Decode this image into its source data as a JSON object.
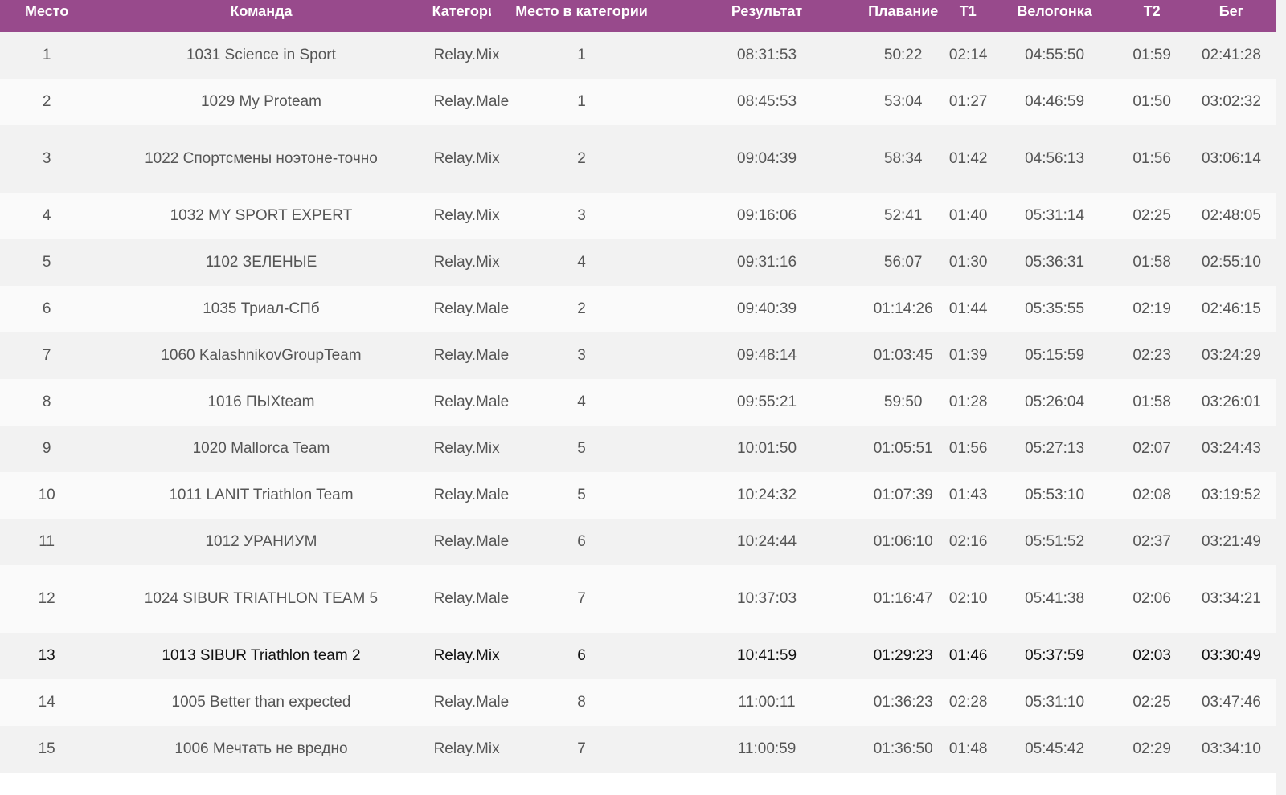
{
  "table": {
    "headers": [
      "Место",
      "Команда",
      "Категория",
      "Место в категории",
      "Результат",
      "Плавание",
      "T1",
      "Велогонка",
      "T2",
      "Бег"
    ],
    "rows": [
      [
        "1",
        "1031 Science in Sport",
        "Relay.Mix",
        "1",
        "08:31:53",
        "50:22",
        "02:14",
        "04:55:50",
        "01:59",
        "02:41:28"
      ],
      [
        "2",
        "1029 My Proteam",
        "Relay.Male",
        "1",
        "08:45:53",
        "53:04",
        "01:27",
        "04:46:59",
        "01:50",
        "03:02:32"
      ],
      [
        "3",
        "1022 Спортсмены ноэтоне-точно",
        "Relay.Mix",
        "2",
        "09:04:39",
        "58:34",
        "01:42",
        "04:56:13",
        "01:56",
        "03:06:14"
      ],
      [
        "4",
        "1032 MY SPORT EXPERT",
        "Relay.Mix",
        "3",
        "09:16:06",
        "52:41",
        "01:40",
        "05:31:14",
        "02:25",
        "02:48:05"
      ],
      [
        "5",
        "1102 ЗЕЛЕНЫЕ",
        "Relay.Mix",
        "4",
        "09:31:16",
        "56:07",
        "01:30",
        "05:36:31",
        "01:58",
        "02:55:10"
      ],
      [
        "6",
        "1035 Триал-СПб",
        "Relay.Male",
        "2",
        "09:40:39",
        "01:14:26",
        "01:44",
        "05:35:55",
        "02:19",
        "02:46:15"
      ],
      [
        "7",
        "1060 KalashnikovGroupTeam",
        "Relay.Male",
        "3",
        "09:48:14",
        "01:03:45",
        "01:39",
        "05:15:59",
        "02:23",
        "03:24:29"
      ],
      [
        "8",
        "1016 ПЫХteam",
        "Relay.Male",
        "4",
        "09:55:21",
        "59:50",
        "01:28",
        "05:26:04",
        "01:58",
        "03:26:01"
      ],
      [
        "9",
        "1020 Mallorca Team",
        "Relay.Mix",
        "5",
        "10:01:50",
        "01:05:51",
        "01:56",
        "05:27:13",
        "02:07",
        "03:24:43"
      ],
      [
        "10",
        "1011 LANIT Triathlon Team",
        "Relay.Male",
        "5",
        "10:24:32",
        "01:07:39",
        "01:43",
        "05:53:10",
        "02:08",
        "03:19:52"
      ],
      [
        "11",
        "1012 УРАНИУМ",
        "Relay.Male",
        "6",
        "10:24:44",
        "01:06:10",
        "02:16",
        "05:51:52",
        "02:37",
        "03:21:49"
      ],
      [
        "12",
        "1024 SIBUR TRIATHLON TEAM 5",
        "Relay.Male",
        "7",
        "10:37:03",
        "01:16:47",
        "02:10",
        "05:41:38",
        "02:06",
        "03:34:21"
      ],
      [
        "13",
        "1013 SIBUR Triathlon team 2",
        "Relay.Mix",
        "6",
        "10:41:59",
        "01:29:23",
        "01:46",
        "05:37:59",
        "02:03",
        "03:30:49"
      ],
      [
        "14",
        "1005 Better than expected",
        "Relay.Male",
        "8",
        "11:00:11",
        "01:36:23",
        "02:28",
        "05:31:10",
        "02:25",
        "03:47:46"
      ],
      [
        "15",
        "1006 Мечтать не вредно",
        "Relay.Mix",
        "7",
        "11:00:59",
        "01:36:50",
        "01:48",
        "05:45:42",
        "02:29",
        "03:34:10"
      ]
    ],
    "tall_rows": [
      2,
      11
    ],
    "highlight_row": 12
  },
  "colors": {
    "header_bg": "#984a8c",
    "header_text": "#ffffff",
    "row_odd": "#f2f2f2",
    "row_even": "#fafafa",
    "cell_text": "#555555",
    "highlight_text": "#111111"
  }
}
